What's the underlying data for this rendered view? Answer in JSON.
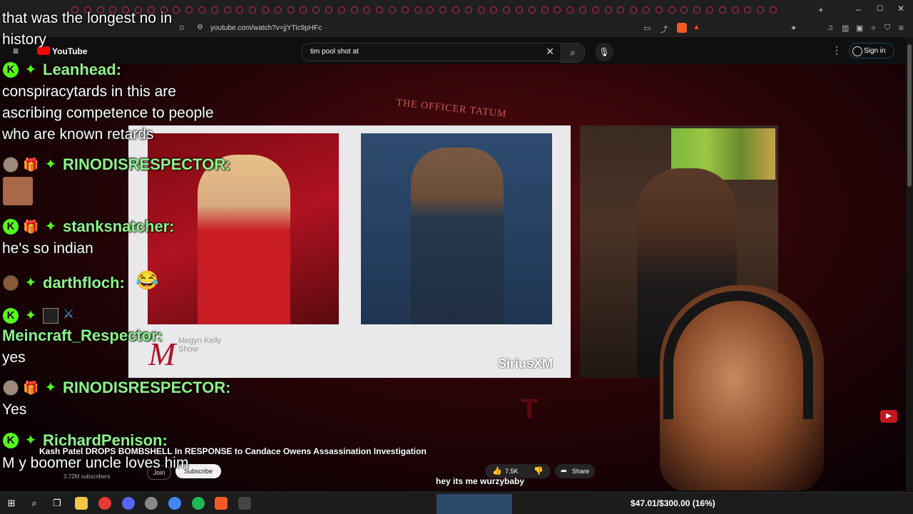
{
  "browser": {
    "url": "youtube.com/watch?v=jjYTic9pHFc"
  },
  "youtube": {
    "logo_text": "YouTube",
    "search_value": "tim pool shot at",
    "search_clear": "✕",
    "search_icon": "search-icon",
    "mic_icon": "mic-icon",
    "more_icon": "⋮",
    "sign_in": "Sign in"
  },
  "video": {
    "banner_text": "THE OFFICER TATUM",
    "mk_logo": "M",
    "mk_logo_text": "Megyn Kelly Show",
    "sirius": "SiriusXM",
    "title": "Kash Patel DROPS BOMBSHELL In RESPONSE to Candace Owens Assassination Investigation",
    "channel_subs": "3.72M subscribers",
    "join": "Join",
    "subscribe": "Subscribe",
    "like_count": "7.5K",
    "share": "Share",
    "caption": "hey its me wurzybaby"
  },
  "chat": {
    "top_msg": "that was the longest no in",
    "top_msg2": "history",
    "messages": [
      {
        "user": "Leanhead:",
        "text1": "conspiracytards in this are",
        "text2": "ascribing competence to people",
        "text3": "who are known retards"
      },
      {
        "user": "RINODISRESPECTOR:",
        "text1": ""
      },
      {
        "user": "stanksnatcher:",
        "text1": "he's so indian"
      },
      {
        "user": "darthfloch:",
        "text1": ""
      },
      {
        "user": "Meincraft_Respector:",
        "text1": "yes"
      },
      {
        "user": "RINODISRESPECTOR:",
        "text1": "Yes"
      },
      {
        "user": "RichardPenison:",
        "text1": "M y boomer uncle loves him"
      }
    ]
  },
  "taskbar": {
    "donation": "$47.01/$300.00 (16%)"
  },
  "colors": {
    "chat_name": "#8ef28a",
    "kick_green": "#53fc18",
    "yt_red": "#ff0000"
  }
}
